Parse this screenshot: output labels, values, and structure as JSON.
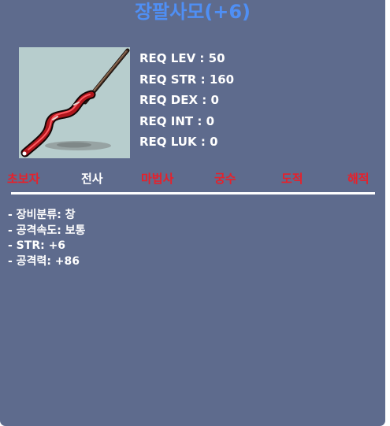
{
  "item": {
    "name": "장팔사모(+6)",
    "icon": "spear-icon"
  },
  "requirements": [
    {
      "label": "REQ LEV",
      "value": "50"
    },
    {
      "label": "REQ STR",
      "value": "160"
    },
    {
      "label": "REQ DEX",
      "value": "0"
    },
    {
      "label": "REQ INT",
      "value": "0"
    },
    {
      "label": "REQ LUK",
      "value": "0"
    }
  ],
  "jobs": [
    {
      "name": "초보자",
      "color": "#e8202a"
    },
    {
      "name": "전사",
      "color": "#ffffff"
    },
    {
      "name": "마법사",
      "color": "#e8202a"
    },
    {
      "name": "궁수",
      "color": "#e8202a"
    },
    {
      "name": "도적",
      "color": "#e8202a"
    },
    {
      "name": "해적",
      "color": "#e8202a"
    }
  ],
  "stats": [
    "- 장비분류: 창",
    "- 공격속도: 보통",
    "- STR: +6",
    "- 공격력: +86"
  ],
  "colors": {
    "panel_bg": "#5e6b8d",
    "title": "#4f8ff5",
    "icon_bg": "#b7cdcd",
    "usable_job": "#ffffff",
    "unusable_job": "#e8202a"
  }
}
